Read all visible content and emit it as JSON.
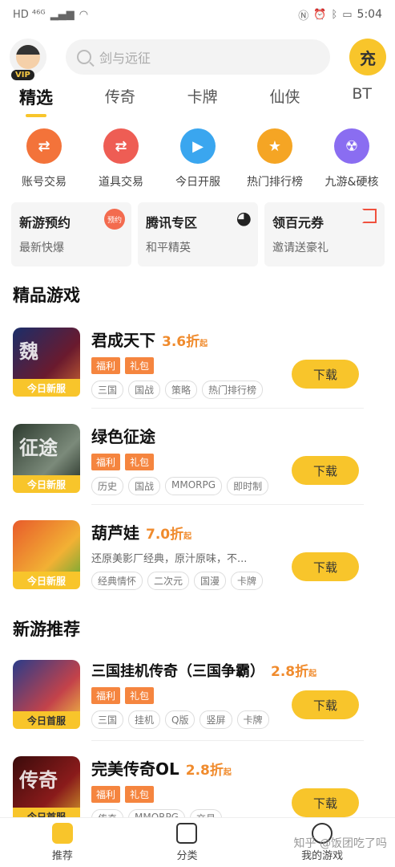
{
  "status_bar": {
    "left": "HD ⁴⁶ᴳ",
    "time": "5:04"
  },
  "header": {
    "vip_label": "VIP",
    "search_placeholder": "剑与远征",
    "recharge_label": "充"
  },
  "tabs": [
    {
      "label": "精选",
      "active": true
    },
    {
      "label": "传奇"
    },
    {
      "label": "卡牌"
    },
    {
      "label": "仙侠"
    },
    {
      "label": "BT"
    }
  ],
  "quick_entries": [
    {
      "label": "账号交易",
      "icon": "account-trade-icon",
      "color": "#f3733a"
    },
    {
      "label": "道具交易",
      "icon": "item-trade-icon",
      "color": "#ee5d54"
    },
    {
      "label": "今日开服",
      "icon": "play-icon",
      "color": "#3aa6ef"
    },
    {
      "label": "热门排行榜",
      "icon": "trophy-icon",
      "color": "#f5a524"
    },
    {
      "label": "九游&硬核",
      "icon": "radiation-icon",
      "color": "#8a6df1"
    }
  ],
  "promos": [
    {
      "title": "新游预约",
      "subtitle": "最新快爆",
      "badge": "预约"
    },
    {
      "title": "腾讯专区",
      "subtitle": "和平精英"
    },
    {
      "title": "领百元券",
      "subtitle": "邀请送豪礼"
    }
  ],
  "sections": {
    "featured": "精品游戏",
    "new": "新游推荐"
  },
  "games": [
    {
      "name": "君成天下",
      "discount": "3.6折",
      "discount_suffix": "起",
      "badges": [
        "福利",
        "礼包"
      ],
      "tags": [
        "三国",
        "国战",
        "策略",
        "热门排行榜"
      ],
      "label": "今日新服",
      "thumb_text": "魏",
      "download": "下载"
    },
    {
      "name": "绿色征途",
      "discount": "",
      "discount_suffix": "",
      "badges": [
        "福利",
        "礼包"
      ],
      "tags": [
        "历史",
        "国战",
        "MMORPG",
        "即时制"
      ],
      "label": "今日新服",
      "thumb_text": "征途",
      "download": "下载"
    },
    {
      "name": "葫芦娃",
      "discount": "7.0折",
      "discount_suffix": "起",
      "desc": "还原美影厂经典，原汁原味，不...",
      "tags": [
        "经典情怀",
        "二次元",
        "国漫",
        "卡牌"
      ],
      "label": "今日新服",
      "thumb_text": "",
      "download": "下载"
    },
    {
      "name": "三国挂机传奇（三国争霸）",
      "discount": "2.8折",
      "discount_suffix": "起",
      "badges": [
        "福利",
        "礼包"
      ],
      "tags": [
        "三国",
        "挂机",
        "Q版",
        "竖屏",
        "卡牌"
      ],
      "label": "今日首服",
      "thumb_text": "",
      "download": "下载"
    },
    {
      "name": "完美传奇OL",
      "discount": "2.8折",
      "discount_suffix": "起",
      "badges": [
        "福利",
        "礼包"
      ],
      "tags": [
        "传奇",
        "MMORPG",
        "交易"
      ],
      "label": "今日首服",
      "thumb_text": "传奇",
      "download": "下载"
    }
  ],
  "bottom_nav": [
    {
      "label": "推荐",
      "active": true
    },
    {
      "label": "分类"
    },
    {
      "label": "我的游戏"
    }
  ],
  "watermark": "知乎 @饭团吃了吗"
}
